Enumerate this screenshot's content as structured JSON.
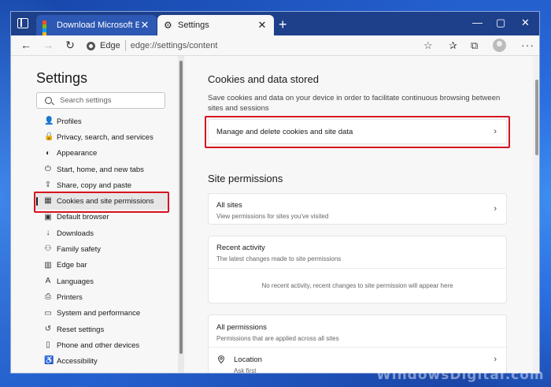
{
  "browser": {
    "tabs": [
      {
        "title": "Download Microsoft Edge Web Br",
        "active": false
      },
      {
        "title": "Settings",
        "active": true
      }
    ],
    "new_tab": "+",
    "window_controls": [
      "—",
      "▢",
      "✕"
    ],
    "address": {
      "site": "Edge",
      "url": "edge://settings/content"
    },
    "icons": [
      "back-icon",
      "forward-icon",
      "refresh-icon",
      "favorites-add-icon",
      "favorites-icon",
      "collections-icon",
      "profile-icon",
      "more-icon"
    ]
  },
  "sidebar": {
    "title": "Settings",
    "search_placeholder": "Search settings",
    "items": [
      {
        "label": "Profiles",
        "icon": "👤",
        "selected": false
      },
      {
        "label": "Privacy, search, and services",
        "icon": "🔒",
        "selected": false
      },
      {
        "label": "Appearance",
        "icon": "◐",
        "selected": false
      },
      {
        "label": "Start, home, and new tabs",
        "icon": "⏻",
        "selected": false
      },
      {
        "label": "Share, copy and paste",
        "icon": "⇪",
        "selected": false
      },
      {
        "label": "Cookies and site permissions",
        "icon": "▦",
        "selected": true
      },
      {
        "label": "Default browser",
        "icon": "▣",
        "selected": false
      },
      {
        "label": "Downloads",
        "icon": "↓",
        "selected": false
      },
      {
        "label": "Family safety",
        "icon": "⚇",
        "selected": false
      },
      {
        "label": "Edge bar",
        "icon": "▥",
        "selected": false
      },
      {
        "label": "Languages",
        "icon": "A",
        "selected": false
      },
      {
        "label": "Printers",
        "icon": "⎙",
        "selected": false
      },
      {
        "label": "System and performance",
        "icon": "▭",
        "selected": false
      },
      {
        "label": "Reset settings",
        "icon": "↺",
        "selected": false
      },
      {
        "label": "Phone and other devices",
        "icon": "▯",
        "selected": false
      },
      {
        "label": "Accessibility",
        "icon": "♿",
        "selected": false
      }
    ]
  },
  "main": {
    "cookies_section": {
      "title": "Cookies and data stored",
      "description": "Save cookies and data on your device in order to facilitate continuous browsing between sites and sessions",
      "manage_link": "Manage and delete cookies and site data"
    },
    "site_permissions": {
      "title": "Site permissions",
      "all_sites": {
        "title": "All sites",
        "subtitle": "View permissions for sites you've visited"
      },
      "recent_activity": {
        "title": "Recent activity",
        "subtitle": "The latest changes made to site permissions",
        "empty": "No recent activity, recent changes to site permission will appear here"
      },
      "all_permissions": {
        "title": "All permissions",
        "subtitle": "Permissions that are applied across all sites",
        "location": {
          "title": "Location",
          "subtitle": "Ask first"
        }
      }
    }
  },
  "watermark": "WindowsDigital.com",
  "colors": {
    "highlight": "#d6131f",
    "tabstrip": "#1e3f8a",
    "wallpaper": "#1b4db0"
  }
}
